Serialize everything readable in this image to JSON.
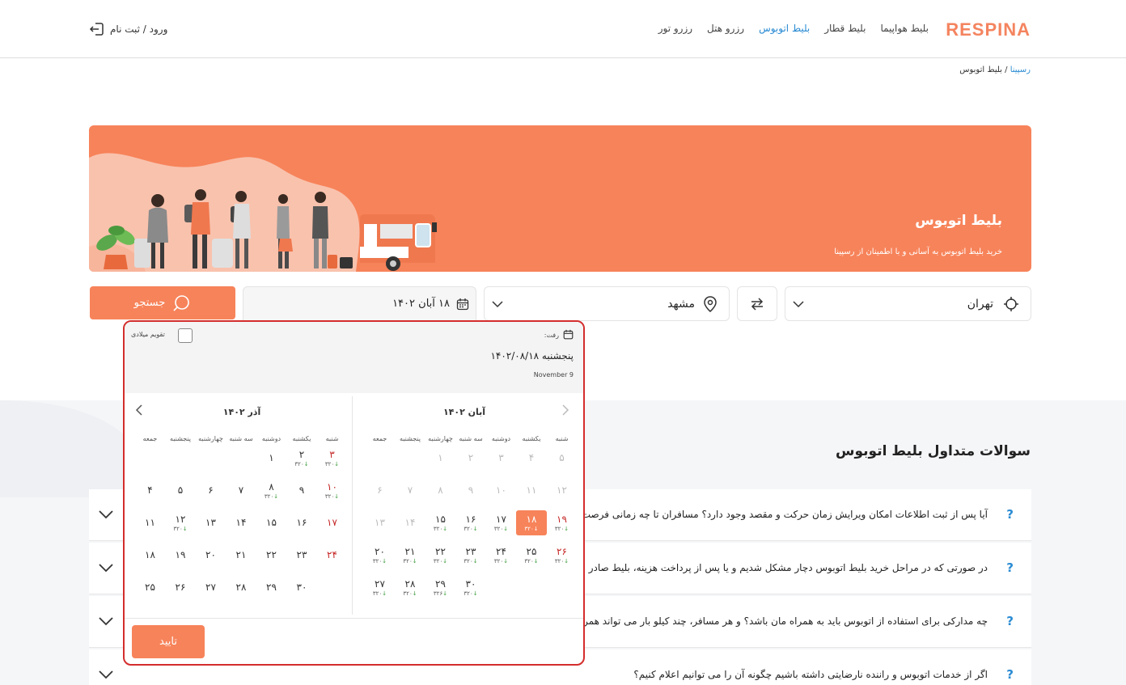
{
  "header": {
    "logo": "RESPINA",
    "nav": [
      "بلیط هواپیما",
      "بلیط قطار",
      "بلیط اتوبوس",
      "رزرو هتل",
      "رزرو تور"
    ],
    "active_nav": "بلیط اتوبوس",
    "login_label": "ورود / ثبت نام"
  },
  "breadcrumb": {
    "home": "رسپینا",
    "sep": "/",
    "current": "بلیط اتوبوس"
  },
  "banner": {
    "title": "بلیط اتوبوس",
    "subtitle": "خرید بلیط اتوبوس به آسانی و با اطمینان از رسپینا"
  },
  "search": {
    "origin": "تهران",
    "destination": "مشهد",
    "date": "۱۸ آبان ۱۴۰۲",
    "button": "جستجو"
  },
  "datepicker": {
    "gregorian_toggle": "تقویم میلادی",
    "depart_label": "رفت:",
    "selected_full": "پنجشنبه ۱۴۰۲/۰۸/۱۸",
    "gregorian_date": "November 9",
    "confirm": "تایید",
    "weekdays": [
      "شنبه",
      "یکشنبه",
      "دوشنبه",
      "سه شنبه",
      "چهارشنبه",
      "پنجشنبه",
      "جمعه"
    ],
    "months": [
      {
        "title": "آبان ۱۴۰۲",
        "days": [
          {
            "n": "۱",
            "c": 5,
            "r": 0,
            "s": "dis"
          },
          {
            "n": "۲",
            "c": 4,
            "r": 0,
            "s": "dis"
          },
          {
            "n": "۳",
            "c": 3,
            "r": 0,
            "s": "dis"
          },
          {
            "n": "۴",
            "c": 2,
            "r": 0,
            "s": "dis"
          },
          {
            "n": "۵",
            "c": 1,
            "r": 0,
            "s": "dis"
          },
          {
            "n": "۶",
            "c": 7,
            "r": 1,
            "s": "dis"
          },
          {
            "n": "۷",
            "c": 6,
            "r": 1,
            "s": "dis"
          },
          {
            "n": "۸",
            "c": 5,
            "r": 1,
            "s": "dis"
          },
          {
            "n": "۹",
            "c": 4,
            "r": 1,
            "s": "dis"
          },
          {
            "n": "۱۰",
            "c": 3,
            "r": 1,
            "s": "dis"
          },
          {
            "n": "۱۱",
            "c": 2,
            "r": 1,
            "s": "dis"
          },
          {
            "n": "۱۲",
            "c": 1,
            "r": 1,
            "s": "dis"
          },
          {
            "n": "۱۳",
            "c": 7,
            "r": 2,
            "s": "dis"
          },
          {
            "n": "۱۴",
            "c": 6,
            "r": 2,
            "s": "dis"
          },
          {
            "n": "۱۵",
            "c": 5,
            "r": 2,
            "p": "۳۲۰"
          },
          {
            "n": "۱۶",
            "c": 4,
            "r": 2,
            "p": "۳۲۰"
          },
          {
            "n": "۱۷",
            "c": 3,
            "r": 2,
            "p": "۳۲۰"
          },
          {
            "n": "۱۸",
            "c": 2,
            "r": 2,
            "p": "۳۲۰",
            "s": "sel"
          },
          {
            "n": "۱۹",
            "c": 1,
            "r": 2,
            "p": "۳۲۰",
            "s": "fri"
          },
          {
            "n": "۲۰",
            "c": 7,
            "r": 3,
            "p": "۳۲۰"
          },
          {
            "n": "۲۱",
            "c": 6,
            "r": 3,
            "p": "۳۲۰"
          },
          {
            "n": "۲۲",
            "c": 5,
            "r": 3,
            "p": "۳۲۰"
          },
          {
            "n": "۲۳",
            "c": 4,
            "r": 3,
            "p": "۳۲۰"
          },
          {
            "n": "۲۴",
            "c": 3,
            "r": 3,
            "p": "۳۲۰"
          },
          {
            "n": "۲۵",
            "c": 2,
            "r": 3,
            "p": "۳۲۰"
          },
          {
            "n": "۲۶",
            "c": 1,
            "r": 3,
            "p": "۳۲۰",
            "s": "fri"
          },
          {
            "n": "۲۷",
            "c": 7,
            "r": 4,
            "p": "۳۲۰"
          },
          {
            "n": "۲۸",
            "c": 6,
            "r": 4,
            "p": "۳۲۰"
          },
          {
            "n": "۲۹",
            "c": 5,
            "r": 4,
            "p": "۳۲۶"
          },
          {
            "n": "۳۰",
            "c": 4,
            "r": 4,
            "p": "۳۲۰"
          }
        ]
      },
      {
        "title": "آذر ۱۴۰۲",
        "days": [
          {
            "n": "۱",
            "c": 3,
            "r": 0
          },
          {
            "n": "۲",
            "c": 2,
            "r": 0,
            "p": "۳۲۰"
          },
          {
            "n": "۳",
            "c": 1,
            "r": 0,
            "p": "۳۲۰",
            "s": "fri"
          },
          {
            "n": "۴",
            "c": 7,
            "r": 1
          },
          {
            "n": "۵",
            "c": 6,
            "r": 1
          },
          {
            "n": "۶",
            "c": 5,
            "r": 1
          },
          {
            "n": "۷",
            "c": 4,
            "r": 1
          },
          {
            "n": "۸",
            "c": 3,
            "r": 1,
            "p": "۳۲۰"
          },
          {
            "n": "۹",
            "c": 2,
            "r": 1
          },
          {
            "n": "۱۰",
            "c": 1,
            "r": 1,
            "p": "۳۲۰",
            "s": "fri"
          },
          {
            "n": "۱۱",
            "c": 7,
            "r": 2
          },
          {
            "n": "۱۲",
            "c": 6,
            "r": 2,
            "p": "۳۲۰"
          },
          {
            "n": "۱۳",
            "c": 5,
            "r": 2
          },
          {
            "n": "۱۴",
            "c": 4,
            "r": 2
          },
          {
            "n": "۱۵",
            "c": 3,
            "r": 2
          },
          {
            "n": "۱۶",
            "c": 2,
            "r": 2
          },
          {
            "n": "۱۷",
            "c": 1,
            "r": 2,
            "s": "fri"
          },
          {
            "n": "۱۸",
            "c": 7,
            "r": 3
          },
          {
            "n": "۱۹",
            "c": 6,
            "r": 3
          },
          {
            "n": "۲۰",
            "c": 5,
            "r": 3
          },
          {
            "n": "۲۱",
            "c": 4,
            "r": 3
          },
          {
            "n": "۲۲",
            "c": 3,
            "r": 3
          },
          {
            "n": "۲۳",
            "c": 2,
            "r": 3
          },
          {
            "n": "۲۴",
            "c": 1,
            "r": 3,
            "s": "fri"
          },
          {
            "n": "۲۵",
            "c": 7,
            "r": 4
          },
          {
            "n": "۲۶",
            "c": 6,
            "r": 4
          },
          {
            "n": "۲۷",
            "c": 5,
            "r": 4
          },
          {
            "n": "۲۸",
            "c": 4,
            "r": 4
          },
          {
            "n": "۲۹",
            "c": 3,
            "r": 4
          },
          {
            "n": "۳۰",
            "c": 2,
            "r": 4
          }
        ]
      }
    ]
  },
  "faq": {
    "title": "سوالات متداول بلیط اتوبوس",
    "items": [
      "آیا پس از ثبت اطلاعات امکان ویرایش زمان حرکت و مقصد وجود دارد؟ مسافران تا چه زمانی فرصت ابطال",
      "در صورتی که در مراحل خرید بلیط اتوبوس دچار مشکل شدیم و یا پس از پرداخت هزینه، بلیط صادر نش",
      "چه مدارکی برای استفاده از اتوبوس باید به همراه مان باشد؟ و هر مسافر، چند کیلو بار می تواند همراه",
      "اگر از خدمات اتوبوس و راننده نارضایتی داشته باشیم چگونه آن را می توانیم اعلام کنیم؟"
    ]
  },
  "colors": {
    "accent": "#f7835a",
    "link": "#2a8bd3",
    "focus_border": "#d42d2d",
    "holiday": "#c62828",
    "price_arrow": "#3a9b3a"
  }
}
